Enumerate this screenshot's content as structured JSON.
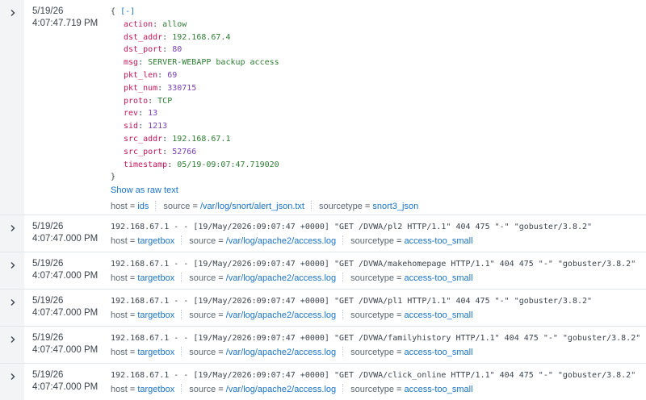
{
  "events": [
    {
      "date": "5/19/26",
      "time": "4:07:47.719 PM",
      "expanded": true,
      "json_open": "{",
      "collapse_label": "[-]",
      "json_close": "}",
      "json_fields": [
        {
          "key": "action",
          "value": "allow",
          "type": "str"
        },
        {
          "key": "dst_addr",
          "value": "192.168.67.4",
          "type": "str"
        },
        {
          "key": "dst_port",
          "value": "80",
          "type": "num"
        },
        {
          "key": "msg",
          "value": "SERVER-WEBAPP backup access",
          "type": "str"
        },
        {
          "key": "pkt_len",
          "value": "69",
          "type": "num"
        },
        {
          "key": "pkt_num",
          "value": "330715",
          "type": "num"
        },
        {
          "key": "proto",
          "value": "TCP",
          "type": "str"
        },
        {
          "key": "rev",
          "value": "13",
          "type": "num"
        },
        {
          "key": "sid",
          "value": "1213",
          "type": "num"
        },
        {
          "key": "src_addr",
          "value": "192.168.67.1",
          "type": "str"
        },
        {
          "key": "src_port",
          "value": "52766",
          "type": "num"
        },
        {
          "key": "timestamp",
          "value": "05/19-09:07:47.719020",
          "type": "str"
        }
      ],
      "raw_link": "Show as raw text",
      "fields": [
        {
          "key": "host",
          "value": "ids"
        },
        {
          "key": "source",
          "value": "/var/log/snort/alert_json.txt"
        },
        {
          "key": "sourcetype",
          "value": "snort3_json"
        }
      ]
    },
    {
      "date": "5/19/26",
      "time": "4:07:47.000 PM",
      "raw": "192.168.67.1 - - [19/May/2026:09:07:47 +0000] \"GET /DVWA/pl2 HTTP/1.1\" 404 475 \"-\" \"gobuster/3.8.2\"",
      "fields": [
        {
          "key": "host",
          "value": "targetbox"
        },
        {
          "key": "source",
          "value": "/var/log/apache2/access.log"
        },
        {
          "key": "sourcetype",
          "value": "access-too_small"
        }
      ]
    },
    {
      "date": "5/19/26",
      "time": "4:07:47.000 PM",
      "raw": "192.168.67.1 - - [19/May/2026:09:07:47 +0000] \"GET /DVWA/makehomepage HTTP/1.1\" 404 475 \"-\" \"gobuster/3.8.2\"",
      "fields": [
        {
          "key": "host",
          "value": "targetbox"
        },
        {
          "key": "source",
          "value": "/var/log/apache2/access.log"
        },
        {
          "key": "sourcetype",
          "value": "access-too_small"
        }
      ]
    },
    {
      "date": "5/19/26",
      "time": "4:07:47.000 PM",
      "raw": "192.168.67.1 - - [19/May/2026:09:07:47 +0000] \"GET /DVWA/pl1 HTTP/1.1\" 404 475 \"-\" \"gobuster/3.8.2\"",
      "fields": [
        {
          "key": "host",
          "value": "targetbox"
        },
        {
          "key": "source",
          "value": "/var/log/apache2/access.log"
        },
        {
          "key": "sourcetype",
          "value": "access-too_small"
        }
      ]
    },
    {
      "date": "5/19/26",
      "time": "4:07:47.000 PM",
      "raw": "192.168.67.1 - - [19/May/2026:09:07:47 +0000] \"GET /DVWA/familyhistory HTTP/1.1\" 404 475 \"-\" \"gobuster/3.8.2\"",
      "fields": [
        {
          "key": "host",
          "value": "targetbox"
        },
        {
          "key": "source",
          "value": "/var/log/apache2/access.log"
        },
        {
          "key": "sourcetype",
          "value": "access-too_small"
        }
      ]
    },
    {
      "date": "5/19/26",
      "time": "4:07:47.000 PM",
      "raw": "192.168.67.1 - - [19/May/2026:09:07:47 +0000] \"GET /DVWA/click_online HTTP/1.1\" 404 475 \"-\" \"gobuster/3.8.2\"",
      "fields": [
        {
          "key": "host",
          "value": "targetbox"
        },
        {
          "key": "source",
          "value": "/var/log/apache2/access.log"
        },
        {
          "key": "sourcetype",
          "value": "access-too_small"
        }
      ]
    }
  ],
  "icons": {
    "expand": "chevron-right-icon"
  },
  "colors": {
    "link": "#1a73c7",
    "json_key": "#c2185b",
    "json_string": "#2e7d32",
    "json_number": "#7b3fb5",
    "gutter": "#f2f4f5"
  }
}
